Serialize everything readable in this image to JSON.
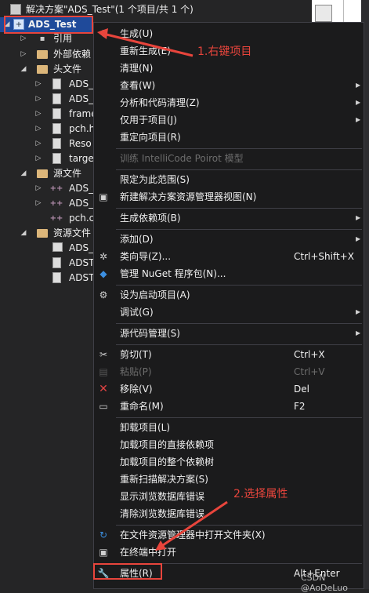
{
  "solution": {
    "label": "解决方案\"ADS_Test\"(1 个项目/共 1 个)",
    "project": "ADS_Test"
  },
  "tree": {
    "items": [
      {
        "label": "引用"
      },
      {
        "label": "外部依赖"
      },
      {
        "label": "头文件"
      },
      {
        "label": "ADS_"
      },
      {
        "label": "ADS_"
      },
      {
        "label": "frame"
      },
      {
        "label": "pch.h"
      },
      {
        "label": "Reso"
      },
      {
        "label": "targe"
      },
      {
        "label": "源文件"
      },
      {
        "label": "ADS_"
      },
      {
        "label": "ADS_"
      },
      {
        "label": "pch.c"
      },
      {
        "label": "资源文件"
      },
      {
        "label": "ADS_"
      },
      {
        "label": "ADST"
      },
      {
        "label": "ADST"
      }
    ]
  },
  "menu": {
    "build": "生成(U)",
    "rebuild": "重新生成(E)",
    "clean": "清理(N)",
    "view": "查看(W)",
    "analyze": "分析和代码清理(Z)",
    "project_only": "仅用于项目(J)",
    "retarget": "重定向项目(R)",
    "train": "训练 IntelliCode Poirot 模型",
    "scope": "限定为此范围(S)",
    "new_view": "新建解决方案资源管理器视图(N)",
    "build_deps": "生成依赖项(B)",
    "add": "添加(D)",
    "class_wizard": "类向导(Z)...",
    "class_wizard_shortcut": "Ctrl+Shift+X",
    "nuget": "管理 NuGet 程序包(N)...",
    "startup": "设为启动项目(A)",
    "debug": "调试(G)",
    "source_control": "源代码管理(S)",
    "cut": "剪切(T)",
    "cut_shortcut": "Ctrl+X",
    "paste": "粘贴(P)",
    "paste_shortcut": "Ctrl+V",
    "remove": "移除(V)",
    "remove_shortcut": "Del",
    "rename": "重命名(M)",
    "rename_shortcut": "F2",
    "unload": "卸载项目(L)",
    "load_direct": "加载项目的直接依赖项",
    "load_tree": "加载项目的整个依赖树",
    "rescan": "重新扫描解决方案(S)",
    "show_db_errors": "显示浏览数据库错误",
    "clear_db_errors": "清除浏览数据库错误",
    "open_folder": "在文件资源管理器中打开文件夹(X)",
    "open_terminal": "在终端中打开",
    "properties": "属性(R)",
    "properties_shortcut": "Alt+Enter"
  },
  "annotations": {
    "step1": "1.右键项目",
    "step2": "2.选择属性"
  },
  "watermark": "CSDN @AoDeLuo",
  "colors": {
    "annotation": "#e8453c",
    "selection": "#1f4a9a",
    "menu_bg": "#1b1b1c"
  }
}
